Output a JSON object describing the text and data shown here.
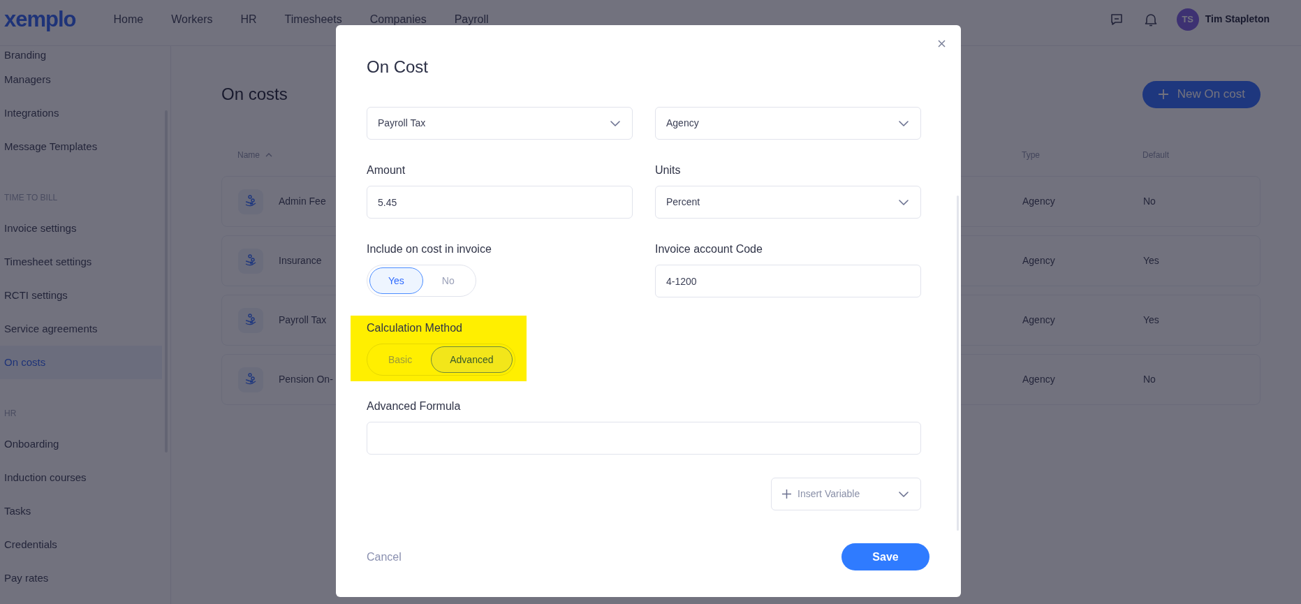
{
  "header": {
    "logo": "xemplo",
    "nav": [
      {
        "label": "Home"
      },
      {
        "label": "Workers"
      },
      {
        "label": "HR"
      },
      {
        "label": "Timesheets"
      },
      {
        "label": "Companies"
      },
      {
        "label": "Payroll"
      }
    ],
    "user": {
      "initials": "TS",
      "name": "Tim Stapleton"
    }
  },
  "sidebar": {
    "items": [
      {
        "kind": "item",
        "label": "Branding",
        "selected": false
      },
      {
        "kind": "item",
        "label": "Managers",
        "selected": false
      },
      {
        "kind": "item",
        "label": "Integrations",
        "selected": false
      },
      {
        "kind": "item",
        "label": "Message Templates",
        "selected": false
      },
      {
        "kind": "section",
        "label": "TIME TO BILL"
      },
      {
        "kind": "item",
        "label": "Invoice settings",
        "selected": false
      },
      {
        "kind": "item",
        "label": "Timesheet settings",
        "selected": false
      },
      {
        "kind": "item",
        "label": "RCTI settings",
        "selected": false
      },
      {
        "kind": "item",
        "label": "Service agreements",
        "selected": false
      },
      {
        "kind": "item",
        "label": "On costs",
        "selected": true
      },
      {
        "kind": "section",
        "label": "HR"
      },
      {
        "kind": "item",
        "label": "Onboarding",
        "selected": false
      },
      {
        "kind": "item",
        "label": "Induction courses",
        "selected": false
      },
      {
        "kind": "item",
        "label": "Tasks",
        "selected": false
      },
      {
        "kind": "item",
        "label": "Credentials",
        "selected": false
      },
      {
        "kind": "item",
        "label": "Pay rates",
        "selected": false
      }
    ]
  },
  "page": {
    "title": "On costs",
    "new_button": "New On cost",
    "table": {
      "columns": [
        "Name",
        "Type",
        "Default"
      ],
      "rows": [
        {
          "name": "Admin Fee",
          "type": "Agency",
          "default": "No"
        },
        {
          "name": "Insurance",
          "type": "Agency",
          "default": "Yes"
        },
        {
          "name": "Payroll Tax",
          "type": "Agency",
          "default": "Yes"
        },
        {
          "name": "Pension On-",
          "type": "Agency",
          "default": "No"
        }
      ]
    }
  },
  "modal": {
    "title": "On Cost",
    "fields": [
      {
        "kind": "select",
        "value": "Payroll Tax"
      },
      {
        "kind": "select",
        "value": "Agency"
      },
      {
        "kind": "input",
        "label": "Amount",
        "value": "5.45"
      },
      {
        "kind": "select",
        "label": "Units",
        "value": "Percent"
      },
      {
        "kind": "toggle",
        "label": "Include on cost in invoice",
        "highlighted": false,
        "options": [
          {
            "label": "Yes",
            "selected": true
          },
          {
            "label": "No",
            "selected": false
          }
        ]
      },
      {
        "kind": "input",
        "label": "Invoice account Code",
        "value": "4-1200"
      },
      {
        "kind": "toggle",
        "label": "Calculation Method",
        "highlighted": true,
        "options": [
          {
            "label": "Basic",
            "selected": false
          },
          {
            "label": "Advanced",
            "selected": true
          }
        ]
      },
      {
        "kind": "input",
        "label": "Advanced Formula",
        "wide": true
      }
    ],
    "insert_variable": "Insert Variable",
    "cancel": "Cancel",
    "save": "Save"
  }
}
